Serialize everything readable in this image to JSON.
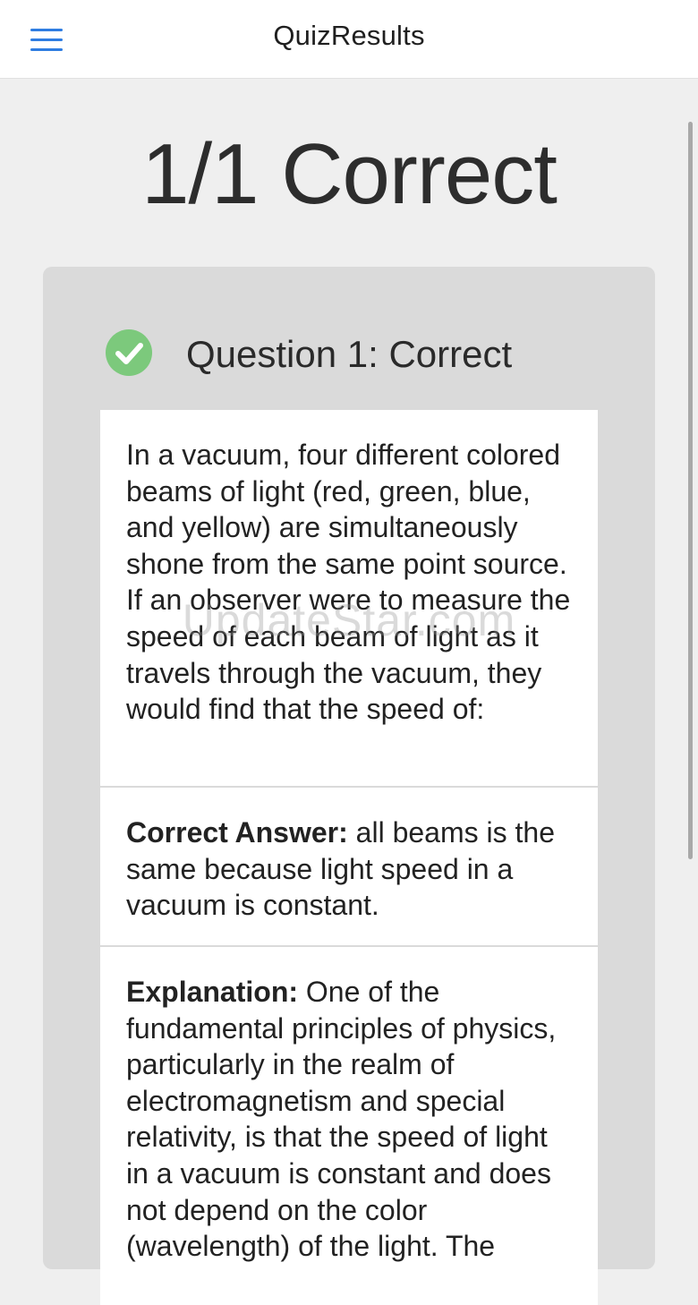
{
  "header": {
    "title": "QuizResults",
    "menu_icon": "hamburger-menu-icon",
    "accent_color": "#2f7de1"
  },
  "score": {
    "text": "1/1 Correct"
  },
  "question": {
    "status_icon": "check-circle-icon",
    "status_color": "#7cc97c",
    "title": "Question 1: Correct",
    "text": "In a vacuum, four different colored beams of light (red, green, blue, and yellow) are simultaneously shone from the same point source. If an observer were to measure the speed of each beam of light as it travels through the vacuum, they would find that the speed of:",
    "answer_label": "Correct Answer:",
    "answer_text": " all beams is the same because light speed in a vacuum is constant.",
    "explanation_label": "Explanation:",
    "explanation_text": " One of the fundamental principles of physics, particularly in the realm of electromagnetism and special relativity, is that the speed of light in a vacuum is constant and does not depend on the color (wavelength) of the light. The"
  },
  "watermark": "UpdateStar.com"
}
